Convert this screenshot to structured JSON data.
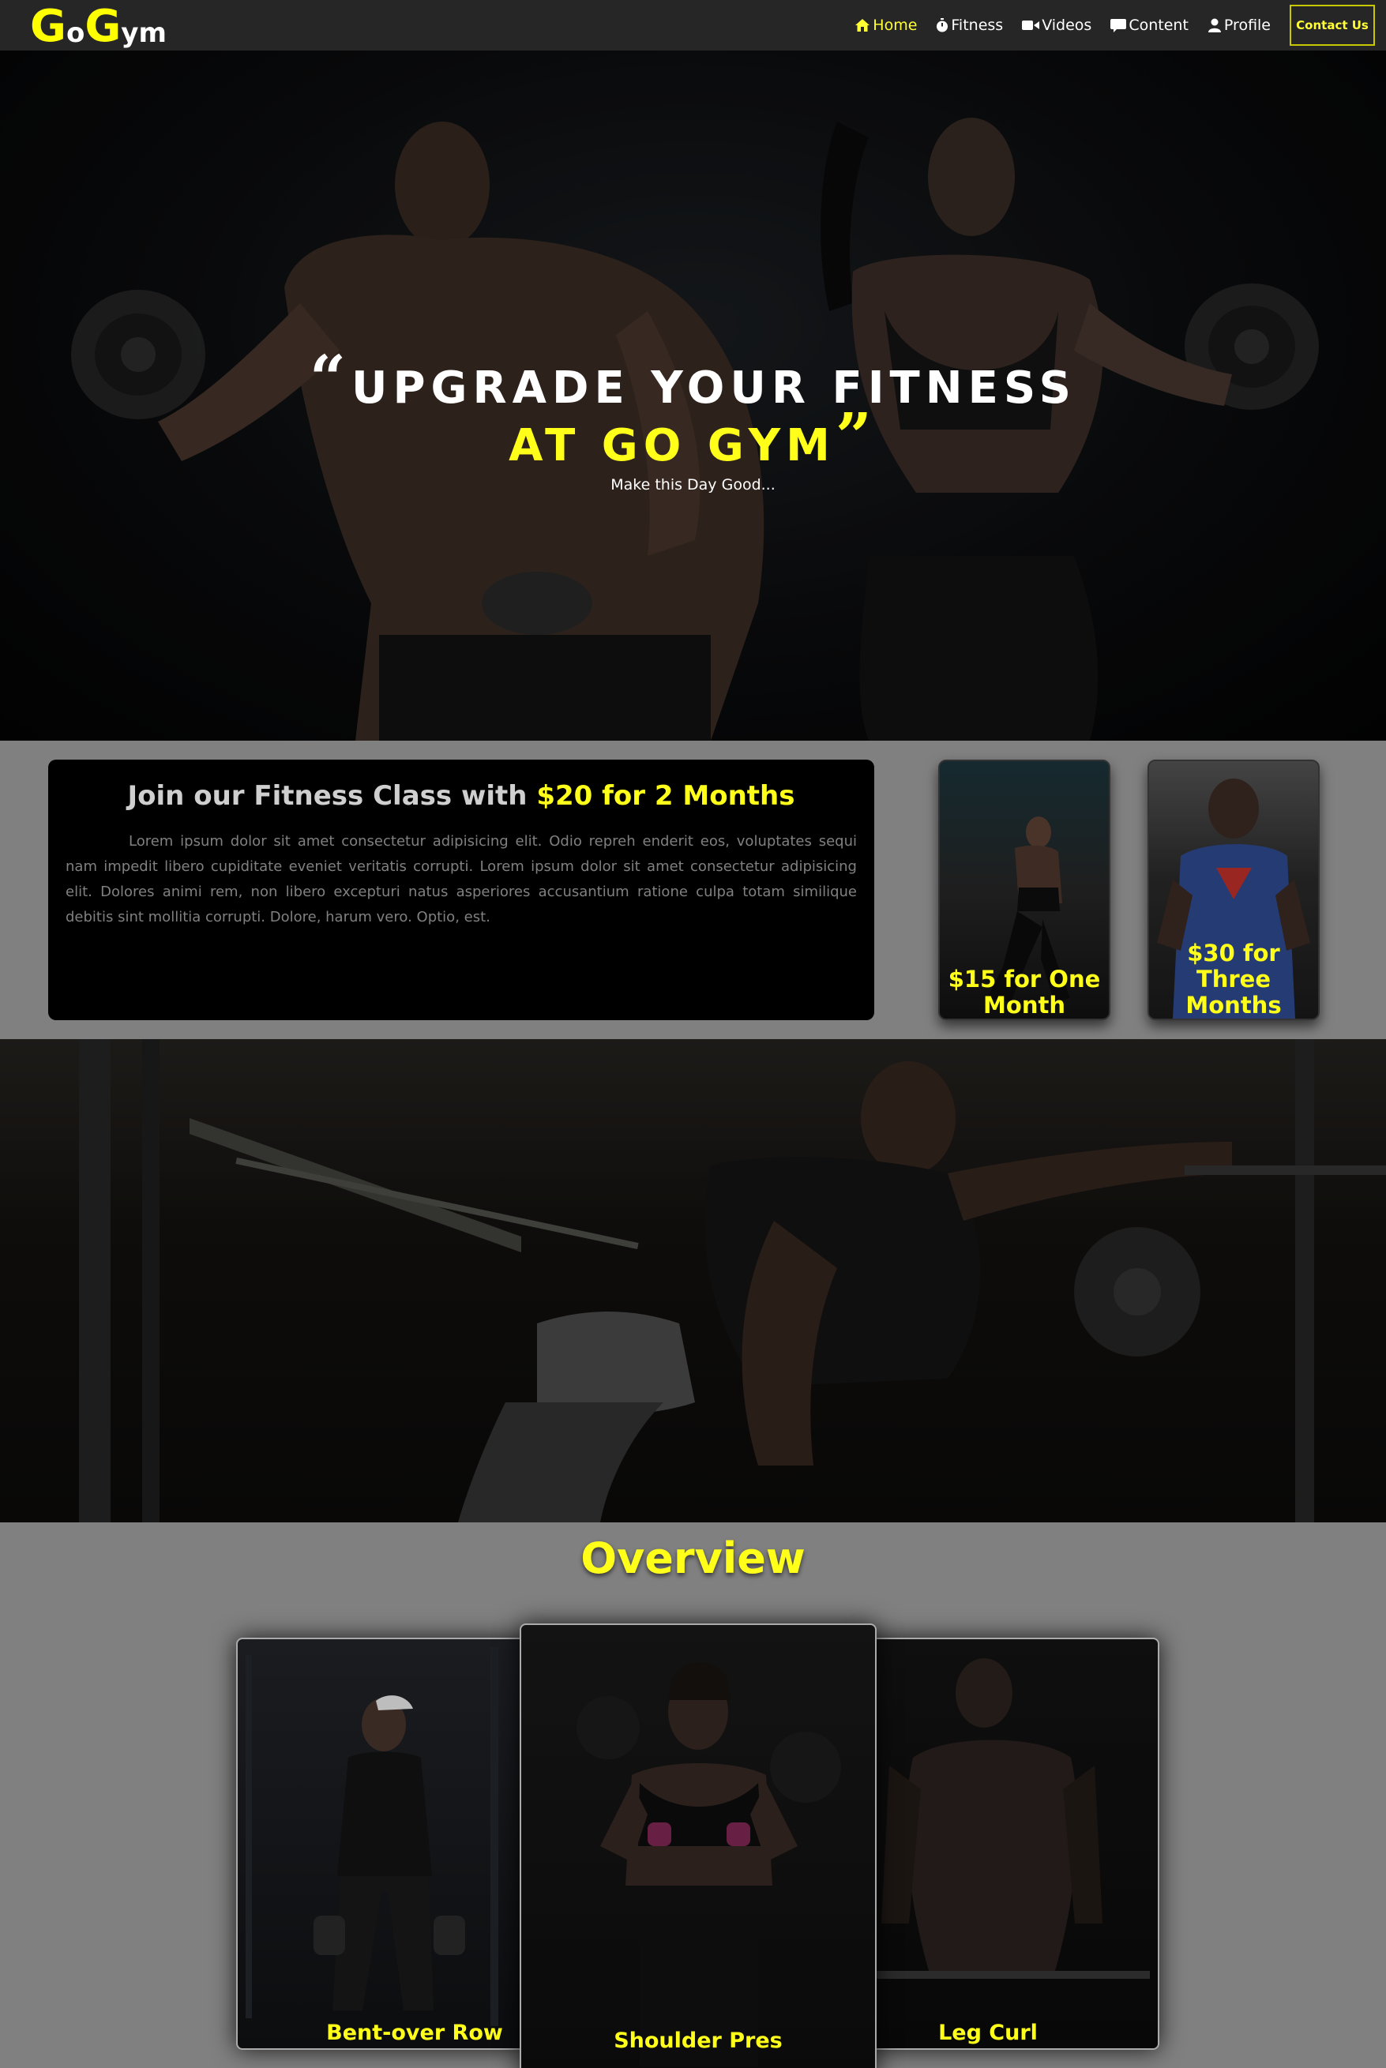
{
  "nav": {
    "logo": {
      "g1": "G",
      "o": "o",
      "g2": "G",
      "ym": "ym"
    },
    "items": [
      {
        "label": "Home",
        "icon": "home-icon",
        "active": true
      },
      {
        "label": "Fitness",
        "icon": "stopwatch-icon",
        "active": false
      },
      {
        "label": "Videos",
        "icon": "video-camera-icon",
        "active": false
      },
      {
        "label": "Content",
        "icon": "comment-icon",
        "active": false
      },
      {
        "label": "Profile",
        "icon": "user-icon",
        "active": false
      }
    ],
    "contact": "Contact Us"
  },
  "hero": {
    "line1": "UPGRADE YOUR FITNESS",
    "line2": "AT GO GYM",
    "open_quote": "“",
    "close_quote": "”",
    "subtitle": "Make this Day Good..."
  },
  "offer": {
    "title_prefix": "Join our Fitness Class with ",
    "title_highlight": "$20 for 2 Months",
    "body": "Lorem ipsum dolor sit amet consectetur adipisicing elit. Odio repreh enderit eos, voluptates sequi nam impedit libero cupiditate eveniet veritatis corrupti. Lorem ipsum dolor sit amet consectetur adipisicing elit. Dolores animi rem, non libero excepturi natus asperiores accusantium ratione culpa totam similique debitis sint mollitia corrupti. Dolore, harum vero. Optio, est.",
    "plans": [
      {
        "label": "$15 for One Month"
      },
      {
        "label": "$30 for Three Months"
      }
    ]
  },
  "overview": {
    "title": "Overview",
    "cards": [
      {
        "label": "Bent-over Row"
      },
      {
        "label": "Shoulder Pres"
      },
      {
        "label": "Leg Curl"
      }
    ]
  },
  "colors": {
    "accent": "#ffff1a",
    "nav_bg": "#262626",
    "section_bg": "#808080"
  }
}
